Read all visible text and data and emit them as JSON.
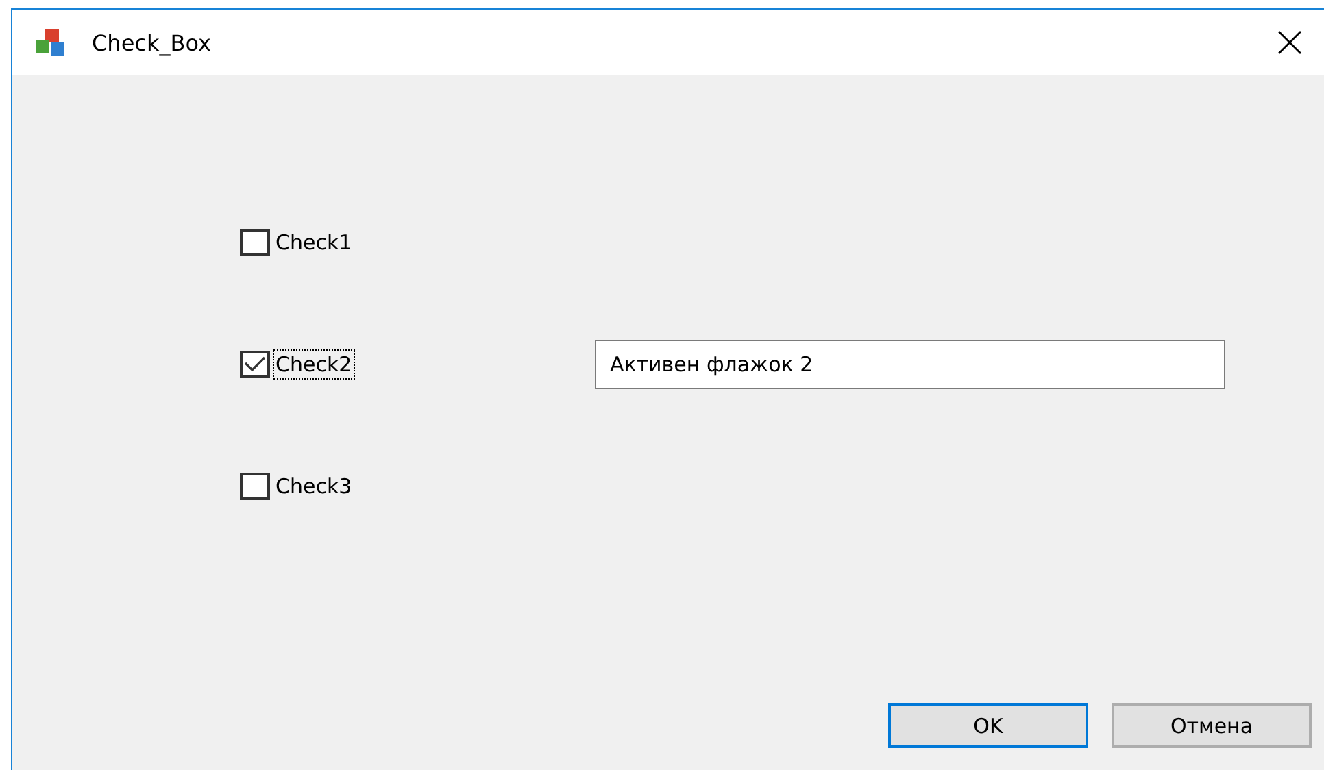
{
  "window": {
    "title": "Check_Box"
  },
  "checkboxes": [
    {
      "label": "Check1",
      "checked": false,
      "focused": false
    },
    {
      "label": "Check2",
      "checked": true,
      "focused": true
    },
    {
      "label": "Check3",
      "checked": false,
      "focused": false
    }
  ],
  "text_field": {
    "value": "Активен флажок 2"
  },
  "buttons": [
    {
      "label": "OK",
      "default": true
    },
    {
      "label": "Отмена",
      "default": false
    }
  ]
}
